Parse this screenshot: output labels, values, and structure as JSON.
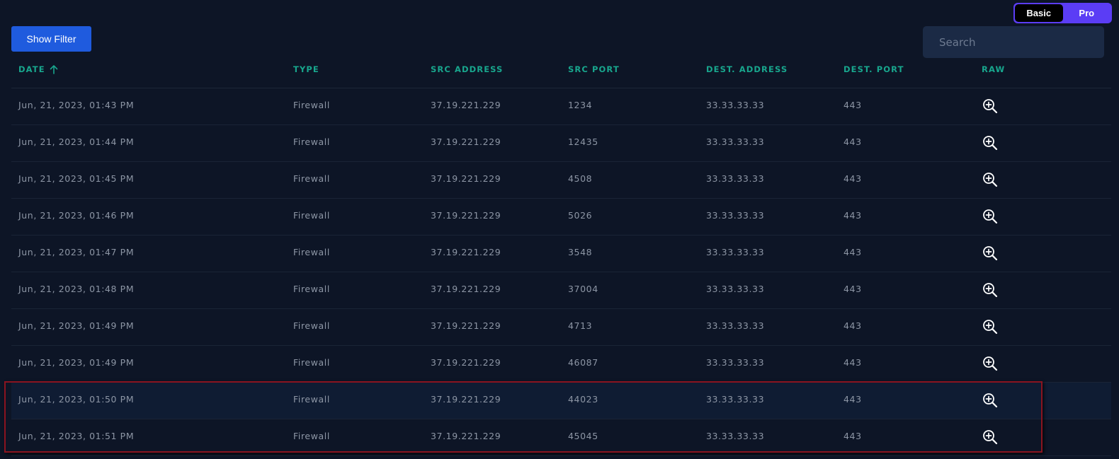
{
  "mode_toggle": {
    "basic_label": "Basic",
    "pro_label": "Pro",
    "selected": "Basic"
  },
  "toolbar": {
    "show_filter_label": "Show Filter"
  },
  "search": {
    "placeholder": "Search",
    "value": ""
  },
  "table": {
    "columns": [
      {
        "key": "date",
        "label": "DATE",
        "sorted": "asc"
      },
      {
        "key": "type",
        "label": "TYPE"
      },
      {
        "key": "src_address",
        "label": "SRC ADDRESS"
      },
      {
        "key": "src_port",
        "label": "SRC PORT"
      },
      {
        "key": "dest_address",
        "label": "DEST. ADDRESS"
      },
      {
        "key": "dest_port",
        "label": "DEST. PORT"
      },
      {
        "key": "raw",
        "label": "RAW"
      }
    ],
    "rows": [
      {
        "date": "Jun, 21, 2023, 01:43 PM",
        "type": "Firewall",
        "src_address": "37.19.221.229",
        "src_port": "1234",
        "dest_address": "33.33.33.33",
        "dest_port": "443",
        "highlighted": false
      },
      {
        "date": "Jun, 21, 2023, 01:44 PM",
        "type": "Firewall",
        "src_address": "37.19.221.229",
        "src_port": "12435",
        "dest_address": "33.33.33.33",
        "dest_port": "443",
        "highlighted": false
      },
      {
        "date": "Jun, 21, 2023, 01:45 PM",
        "type": "Firewall",
        "src_address": "37.19.221.229",
        "src_port": "4508",
        "dest_address": "33.33.33.33",
        "dest_port": "443",
        "highlighted": false
      },
      {
        "date": "Jun, 21, 2023, 01:46 PM",
        "type": "Firewall",
        "src_address": "37.19.221.229",
        "src_port": "5026",
        "dest_address": "33.33.33.33",
        "dest_port": "443",
        "highlighted": false
      },
      {
        "date": "Jun, 21, 2023, 01:47 PM",
        "type": "Firewall",
        "src_address": "37.19.221.229",
        "src_port": "3548",
        "dest_address": "33.33.33.33",
        "dest_port": "443",
        "highlighted": false
      },
      {
        "date": "Jun, 21, 2023, 01:48 PM",
        "type": "Firewall",
        "src_address": "37.19.221.229",
        "src_port": "37004",
        "dest_address": "33.33.33.33",
        "dest_port": "443",
        "highlighted": false
      },
      {
        "date": "Jun, 21, 2023, 01:49 PM",
        "type": "Firewall",
        "src_address": "37.19.221.229",
        "src_port": "4713",
        "dest_address": "33.33.33.33",
        "dest_port": "443",
        "highlighted": false
      },
      {
        "date": "Jun, 21, 2023, 01:49 PM",
        "type": "Firewall",
        "src_address": "37.19.221.229",
        "src_port": "46087",
        "dest_address": "33.33.33.33",
        "dest_port": "443",
        "highlighted": false
      },
      {
        "date": "Jun, 21, 2023, 01:50 PM",
        "type": "Firewall",
        "src_address": "37.19.221.229",
        "src_port": "44023",
        "dest_address": "33.33.33.33",
        "dest_port": "443",
        "highlighted": true
      },
      {
        "date": "Jun, 21, 2023, 01:51 PM",
        "type": "Firewall",
        "src_address": "37.19.221.229",
        "src_port": "45045",
        "dest_address": "33.33.33.33",
        "dest_port": "443",
        "highlighted": false
      }
    ],
    "raw_icon": "zoom-in-icon",
    "sort_icon": "arrow-up-icon"
  },
  "colors": {
    "background": "#0d1526",
    "header_text": "#18a68d",
    "cell_text": "#8d96a5",
    "accent_button": "#1f5bde",
    "toggle_active": "#5b3df5",
    "highlight_row": "#0f1c33",
    "selection_outline": "#8a1420"
  }
}
